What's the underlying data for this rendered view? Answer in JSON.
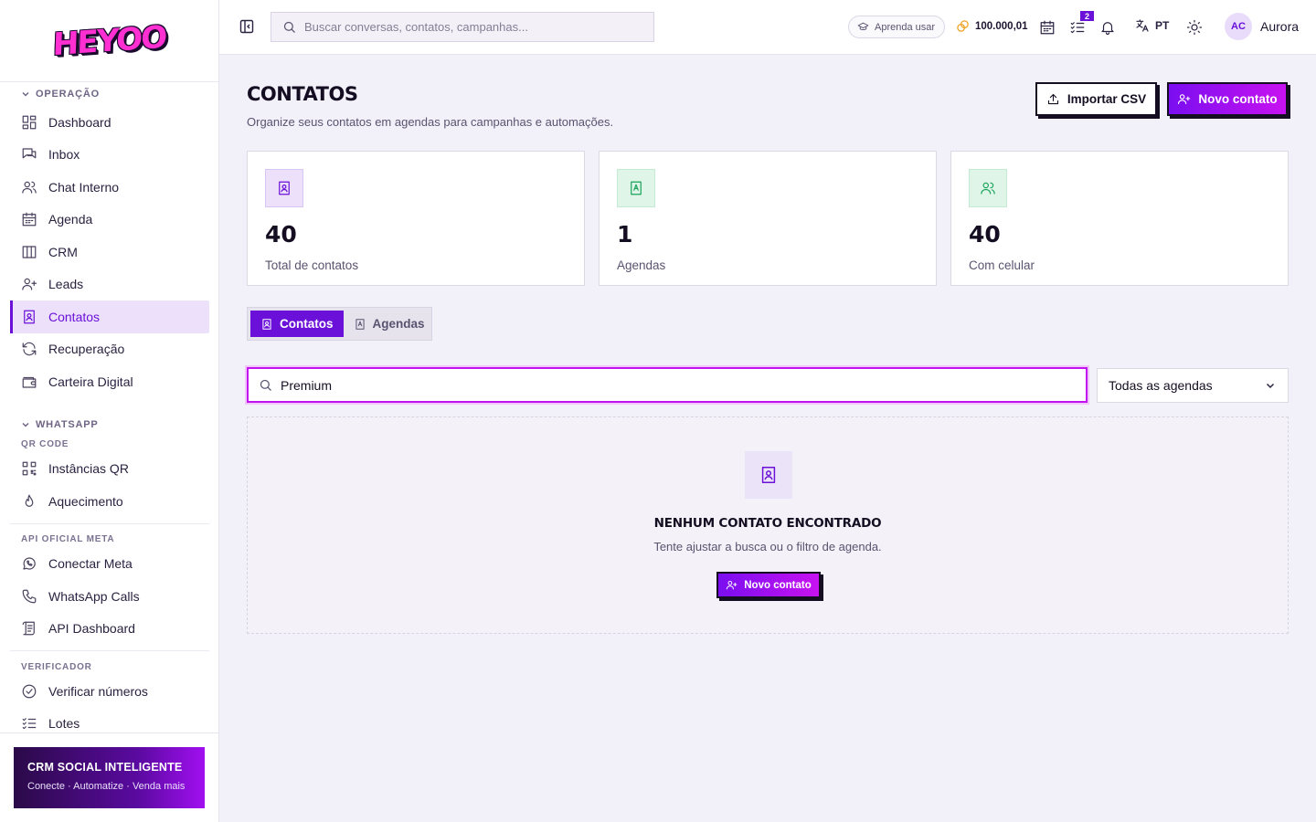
{
  "brand": {
    "logo_text": "HEYOO"
  },
  "sidebar": {
    "groups": {
      "operacao": "OPERAÇÃO",
      "whatsapp": "WHATSAPP",
      "qrcode": "QR CODE",
      "api_meta": "API OFICIAL META",
      "verificador": "VERIFICADOR"
    },
    "items": {
      "dashboard": "Dashboard",
      "inbox": "Inbox",
      "chat": "Chat Interno",
      "agenda": "Agenda",
      "crm": "CRM",
      "leads": "Leads",
      "contatos": "Contatos",
      "recuperacao": "Recuperação",
      "carteira": "Carteira Digital",
      "instancias": "Instâncias QR",
      "aquecimento": "Aquecimento",
      "conectar_meta": "Conectar Meta",
      "calls": "WhatsApp Calls",
      "api_dashboard": "API Dashboard",
      "verificar": "Verificar números",
      "lotes": "Lotes"
    },
    "active_item": "Contatos",
    "promo": {
      "title": "CRM SOCIAL INTELIGENTE",
      "subtitle": "Conecte · Automatize · Venda mais"
    }
  },
  "topbar": {
    "search_placeholder": "Buscar conversas, contatos, campanhas...",
    "learn_label": "Aprenda usar",
    "credits": "100.000,01",
    "tasks_badge": "2",
    "language": "PT",
    "user": {
      "initials": "AC",
      "name": "Aurora"
    }
  },
  "page": {
    "title": "CONTATOS",
    "subtitle": "Organize seus contatos em agendas para campanhas e automações.",
    "import_label": "Importar CSV",
    "new_contact_label": "Novo contato"
  },
  "stats": [
    {
      "value": "40",
      "label": "Total de contatos"
    },
    {
      "value": "1",
      "label": "Agendas"
    },
    {
      "value": "40",
      "label": "Com celular"
    }
  ],
  "tabs": [
    {
      "label": "Contatos",
      "active": true
    },
    {
      "label": "Agendas",
      "active": false
    }
  ],
  "filters": {
    "search_value": "Premium",
    "agenda_select": "Todas as agendas"
  },
  "empty_state": {
    "title": "NENHUM CONTATO ENCONTRADO",
    "subtitle": "Tente ajustar a busca ou o filtro de agenda.",
    "button_label": "Novo contato"
  },
  "colors": {
    "accent": "#6a10d8",
    "accent_gradient_end": "#c812f0",
    "stat_icon_1": "#ece0fb",
    "stat_icon_2": "#dff5e8",
    "stat_icon_3": "#dff5e8"
  }
}
